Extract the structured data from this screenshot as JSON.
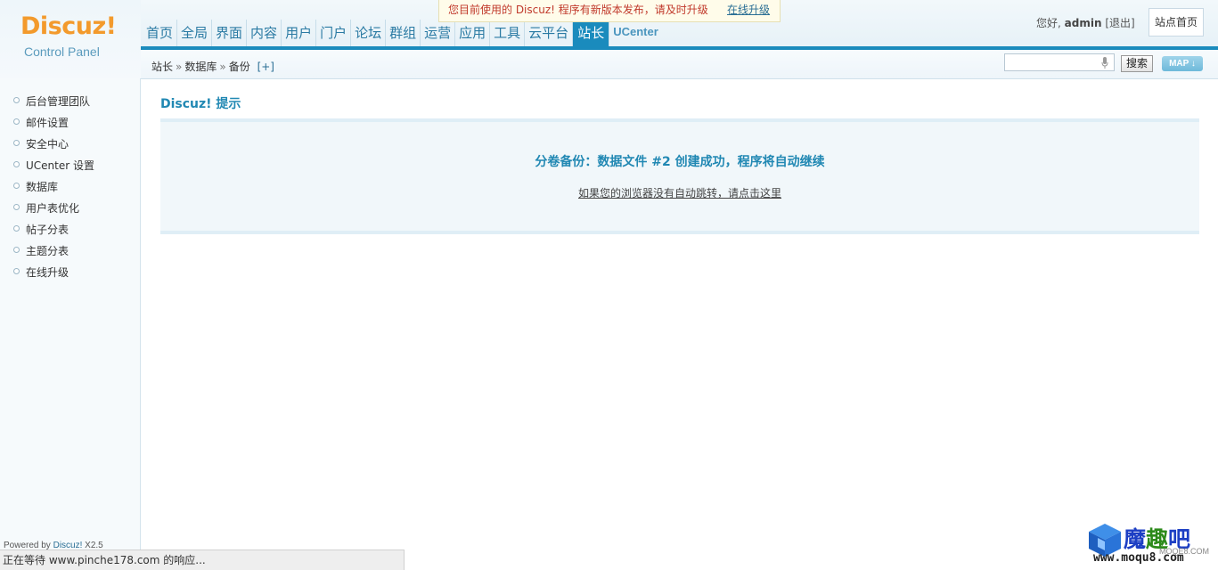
{
  "header": {
    "logo_text": "Discuz!",
    "logo_subtitle": "Control Panel",
    "nav": [
      {
        "label": "首页"
      },
      {
        "label": "全局"
      },
      {
        "label": "界面"
      },
      {
        "label": "内容"
      },
      {
        "label": "用户"
      },
      {
        "label": "门户"
      },
      {
        "label": "论坛"
      },
      {
        "label": "群组"
      },
      {
        "label": "运营"
      },
      {
        "label": "应用"
      },
      {
        "label": "工具"
      },
      {
        "label": "云平台"
      },
      {
        "label": "站长"
      },
      {
        "label": "UCenter"
      }
    ],
    "active_nav": "站长",
    "greeting": "您好,",
    "username": "admin",
    "logout_label": "[退出]",
    "site_home_label": "站点首页"
  },
  "update_notice": {
    "text": "您目前使用的 Discuz! 程序有新版本发布，请及时升级",
    "link_label": "在线升级"
  },
  "breadcrumb": {
    "items": [
      "站长",
      "数据库",
      "备份"
    ],
    "separator": "»",
    "add_label": "[+]"
  },
  "search": {
    "value": "",
    "button_label": "搜索",
    "map_label": "MAP"
  },
  "sidebar": {
    "items": [
      {
        "label": "后台管理团队"
      },
      {
        "label": "邮件设置"
      },
      {
        "label": "安全中心"
      },
      {
        "label": "UCenter 设置"
      },
      {
        "label": "数据库"
      },
      {
        "label": "用户表优化"
      },
      {
        "label": "帖子分表"
      },
      {
        "label": "主题分表"
      },
      {
        "label": "在线升级"
      }
    ],
    "powered_prefix": "Powered by",
    "powered_product": "Discuz!",
    "powered_version": "X2.5"
  },
  "main": {
    "title": "Discuz! 提示",
    "message": "分卷备份：数据文件 #2 创建成功，程序将自动继续",
    "redirect_link": "如果您的浏览器没有自动跳转，请点击这里"
  },
  "statusbar": {
    "text": "正在等待 www.pinche178.com 的响应..."
  },
  "watermark": {
    "cn_1": "魔",
    "cn_2": "趣",
    "cn_3": "吧",
    "small": "MOQE8.COM",
    "url": "www.moqu8.com"
  },
  "colors": {
    "accent": "#1a8bbd",
    "logo_orange": "#f39a2c",
    "notice_red": "#c0392b",
    "title_blue": "#2188b3"
  }
}
